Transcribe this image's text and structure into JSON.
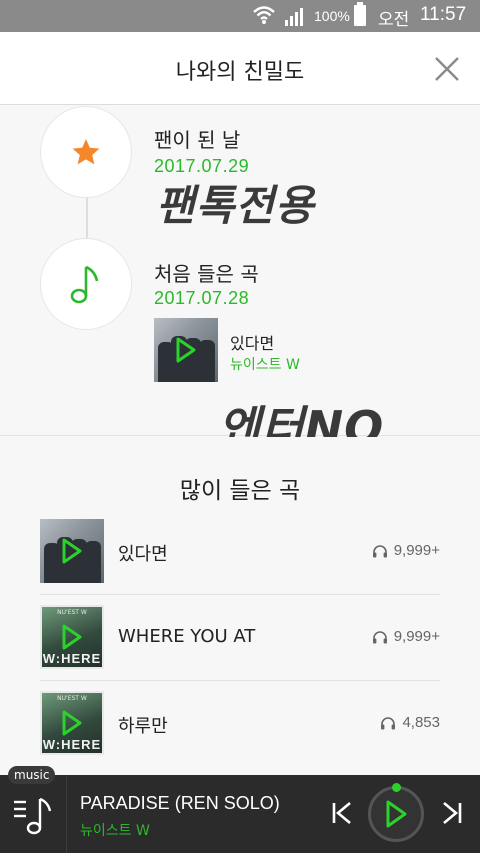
{
  "status_bar": {
    "battery": "100%",
    "ampm": "오전",
    "time": "11:57"
  },
  "header": {
    "title": "나와의 친밀도",
    "close_icon": "close-icon"
  },
  "timeline": {
    "fan_label": "팬이 된 날",
    "fan_date": "2017.07.29",
    "first_listen_label": "처음 들은 곡",
    "first_listen_date": "2017.07.28",
    "first_song": {
      "title": "있다면",
      "artist": "뉴이스트 W"
    }
  },
  "watermarks": [
    "팬톡전용",
    "엔터NO"
  ],
  "most_played": {
    "heading": "많이 들은 곡",
    "songs": [
      {
        "title": "있다면",
        "count": "9,999+",
        "art": "photo"
      },
      {
        "title": "WHERE YOU AT",
        "count": "9,999+",
        "art": "where"
      },
      {
        "title": "하루만",
        "count": "4,853",
        "art": "where"
      }
    ]
  },
  "album_art": {
    "where_caption": "W:HERE",
    "where_top": "NU'EST W"
  },
  "player": {
    "badge": "music",
    "title": "PARADISE (REN SOLO)",
    "artist": "뉴이스트 W"
  },
  "colors": {
    "accent_green": "#2cb82c",
    "star_orange": "#f5872b",
    "player_bg": "#2b2b2b"
  }
}
